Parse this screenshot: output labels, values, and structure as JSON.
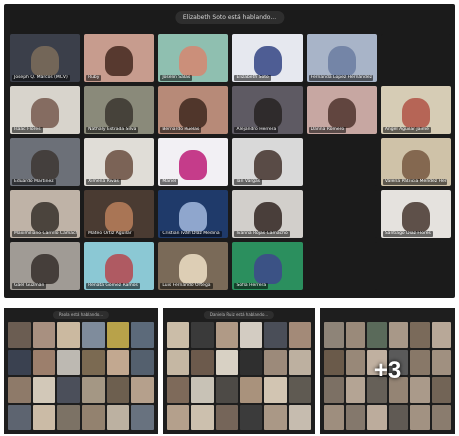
{
  "meeting": {
    "pill_text": "Elizabeth Soto está hablando..."
  },
  "tiles": [
    {
      "name": "Joseph Q. Marcos (MCV)",
      "bg": "#3b3f4a",
      "fg": "#7a6a5a"
    },
    {
      "name": "Ruby",
      "bg": "#c79c8e",
      "fg": "#4a2f25"
    },
    {
      "name": "Joselin Salas",
      "bg": "#8fbfb0",
      "fg": "#d28a74"
    },
    {
      "name": "Elizabeth Soto",
      "bg": "#e6e8ef",
      "fg": "#3d4e8a"
    },
    {
      "name": "Fernanda Lopez Hernández",
      "bg": "#a8b4c8",
      "fg": "#6e7fa3"
    },
    {
      "name": "",
      "bg": "#1b1b1b",
      "fg": "#1b1b1b",
      "empty": true
    },
    {
      "name": "Isaac Flores",
      "bg": "#d8d4cc",
      "fg": "#7c6155"
    },
    {
      "name": "Nathaly Estrada Silva",
      "bg": "#8a8a7a",
      "fg": "#3e3a33"
    },
    {
      "name": "Bernardo Ruelas",
      "bg": "#b78a78",
      "fg": "#452c22"
    },
    {
      "name": "Alejandro Herrera",
      "bg": "#5e5a63",
      "fg": "#2a2626"
    },
    {
      "name": "Danna Romero",
      "bg": "#c7a7a2",
      "fg": "#553b34"
    },
    {
      "name": "Ángel Aguilar Jaime",
      "bg": "#d6ccb5",
      "fg": "#b25a4b"
    },
    {
      "name": "Eduardo Martínez",
      "bg": "#6c7078",
      "fg": "#403a36"
    },
    {
      "name": "Ximena Rivas",
      "bg": "#e0ddd7",
      "fg": "#705548"
    },
    {
      "name": "Mariel",
      "bg": "#f2f0f4",
      "fg": "#c0287e"
    },
    {
      "name": "Ian Vargas",
      "bg": "#d9d9d9",
      "fg": "#4a3b35"
    },
    {
      "name": "",
      "bg": "#1b1b1b",
      "fg": "#1b1b1b",
      "empty": true
    },
    {
      "name": "Valeria Patricia Méndez Hernández",
      "bg": "#cfc2a8",
      "fg": "#7b5e46"
    },
    {
      "name": "Maximiliano Carrillo Camacho",
      "bg": "#bfb3a7",
      "fg": "#3e3732"
    },
    {
      "name": "Mateo Ortiz Aguilar",
      "bg": "#4a3b32",
      "fg": "#b47c59"
    },
    {
      "name": "Cristian Iván Díaz Medina",
      "bg": "#1f3a6a",
      "fg": "#9bb3d8"
    },
    {
      "name": "Ivanna Rojas Camacho",
      "bg": "#d2cfcb",
      "fg": "#3a2e2a"
    },
    {
      "name": "",
      "bg": "#1b1b1b",
      "fg": "#1b1b1b",
      "empty": true
    },
    {
      "name": "Santiago Díaz Flores",
      "bg": "#e5e2de",
      "fg": "#4f4038"
    },
    {
      "name": "Gael Guzmán",
      "bg": "#a09b95",
      "fg": "#3b3430"
    },
    {
      "name": "Renata Gómez Ramos",
      "bg": "#8bc8d4",
      "fg": "#b24e55"
    },
    {
      "name": "Luis Fernando Ortega",
      "bg": "#7a6a58",
      "fg": "#e8d9c0"
    },
    {
      "name": "Sofía Herrera",
      "bg": "#2b8f5e",
      "fg": "#3d4b8a"
    },
    {
      "name": "",
      "bg": "#1b1b1b",
      "fg": "#1b1b1b",
      "empty": true
    }
  ],
  "thumbnails": [
    {
      "header": "Paola está hablando...",
      "more": "",
      "colors": [
        "#6b5d52",
        "#a89080",
        "#cbb9a0",
        "#7f8c9c",
        "#b8a24a",
        "#5c6a7a",
        "#3a4150",
        "#9c7f6c",
        "#bdb9b2",
        "#7b6a52",
        "#c2a890",
        "#54606e",
        "#8e7a69",
        "#d2c8b8",
        "#4b4f5a",
        "#a49784",
        "#6d5f4f",
        "#b5a08c",
        "#5d6470",
        "#cbbba6",
        "#7c7265",
        "#93826f",
        "#bcb1a1",
        "#68727f"
      ]
    },
    {
      "header": "Daniela Ruiz está hablando...",
      "more": "",
      "colors": [
        "#cbbda8",
        "#3a3a3a",
        "#b09a86",
        "#d3ccc2",
        "#4a4e58",
        "#a38a78",
        "#c5b7a3",
        "#6c5a4c",
        "#d8d1c4",
        "#2f2f2f",
        "#9c8a7a",
        "#bdb0a0",
        "#7e6a5a",
        "#c8c2b6",
        "#4d4a46",
        "#a9927c",
        "#d2c5b2",
        "#5f5a52",
        "#b4a08c",
        "#ccc0ae",
        "#756559",
        "#3b3b3b",
        "#aa9886",
        "#c6bcaf"
      ]
    },
    {
      "header": "",
      "more": "+3",
      "colors": [
        "#8e8478",
        "#9a8a7a",
        "#5a6a5a",
        "#a89888",
        "#7a6a5a",
        "#b8a898",
        "#6a5a4a",
        "#988878",
        "#c0b0a0",
        "#5a5a5a",
        "#887868",
        "#a09080",
        "#7c7064",
        "#b4a494",
        "#666058",
        "#948474",
        "#aa9a8a",
        "#726456",
        "#9e8e7e",
        "#84786c",
        "#bcac9c",
        "#605a54",
        "#a29282",
        "#8a7c6e"
      ]
    }
  ]
}
